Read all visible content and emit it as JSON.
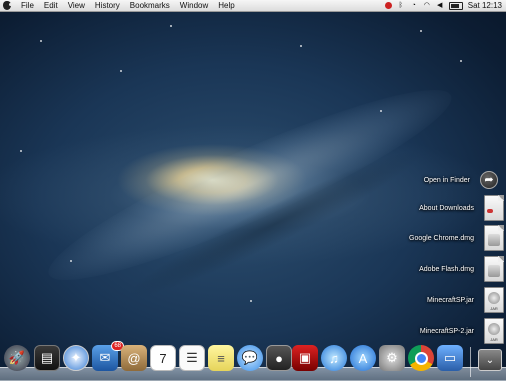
{
  "menubar": {
    "items": [
      "File",
      "Edit",
      "View",
      "History",
      "Bookmarks",
      "Window",
      "Help"
    ],
    "clock": "Sat 12:13"
  },
  "downloads_stack": {
    "open_in_finder": "Open in Finder",
    "items": [
      {
        "label": "About Downloads"
      },
      {
        "label": "Google Chrome.dmg"
      },
      {
        "label": "Adobe Flash.dmg"
      },
      {
        "label": "MinecraftSP.jar",
        "icon_text": "JAR"
      },
      {
        "label": "MinecraftSP-2.jar",
        "icon_text": "JAR"
      }
    ]
  },
  "dock": {
    "mail_badge": "68",
    "calendar_day": "7"
  }
}
